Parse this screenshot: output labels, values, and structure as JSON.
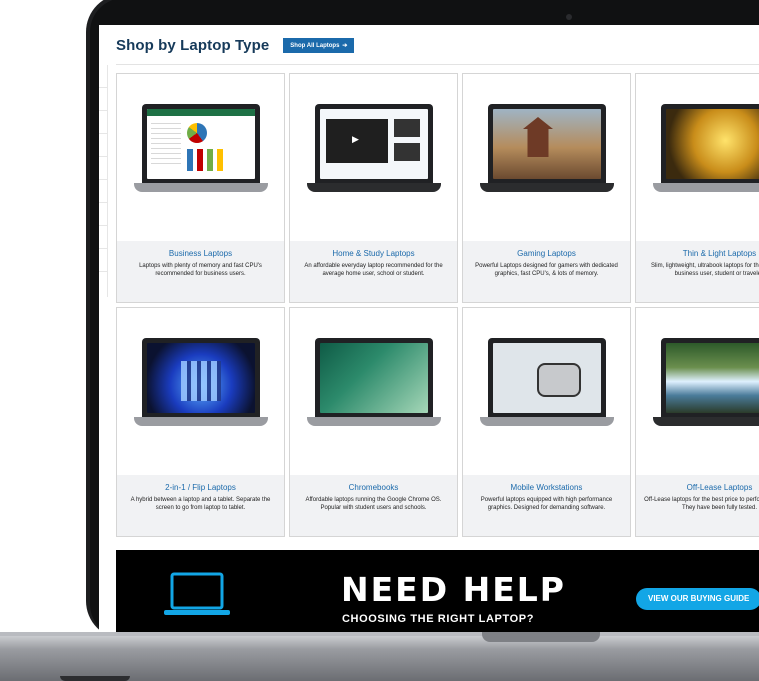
{
  "header": {
    "title": "Shop by Laptop Type",
    "shop_all_label": "Shop All Laptops",
    "arrow_icon": "arrow-right-icon"
  },
  "categories": [
    {
      "name": "Business Laptops",
      "desc": "Laptops with plenty of memory and fast CPU's recommended for business users.",
      "icon": "spreadsheet-laptop-image"
    },
    {
      "name": "Home & Study Laptops",
      "desc": "An affordable everyday laptop recommended for the average home user, school or student.",
      "icon": "video-laptop-image"
    },
    {
      "name": "Gaming Laptops",
      "desc": "Powerful Laptops designed for gamers with dedicated graphics, fast CPU's, & lots of memory.",
      "icon": "game-laptop-image"
    },
    {
      "name": "Thin & Light Laptops",
      "desc": "Slim, lightweight, ultrabook laptops for the everyday business user, student or traveler.",
      "icon": "gold-wallpaper-laptop-image"
    },
    {
      "name": "2-in-1 / Flip Laptops",
      "desc": "A hybrid between a laptop and a tablet. Separate the screen to go from laptop to tablet.",
      "icon": "windows-flip-laptop-image"
    },
    {
      "name": "Chromebooks",
      "desc": "Affordable laptops running the Google Chrome OS. Popular with student users and schools.",
      "icon": "chromebook-image"
    },
    {
      "name": "Mobile Workstations",
      "desc": "Powerful laptops equipped with high performance graphics. Designed for demanding software.",
      "icon": "cad-laptop-image"
    },
    {
      "name": "Off-Lease Laptops",
      "desc": "Off-Lease laptops for the best price to performance ratio. They have been fully tested.",
      "icon": "waterfall-laptop-image"
    }
  ],
  "banner": {
    "headline": "NEED HELP",
    "subline": "CHOOSING THE RIGHT LAPTOP?",
    "button_label": "VIEW OUR BUYING GUIDE",
    "icon": "laptop-outline-icon"
  },
  "colors": {
    "title": "#163a5a",
    "accent": "#1b6aab",
    "banner_bg": "#000000",
    "banner_button": "#12a6e6"
  }
}
